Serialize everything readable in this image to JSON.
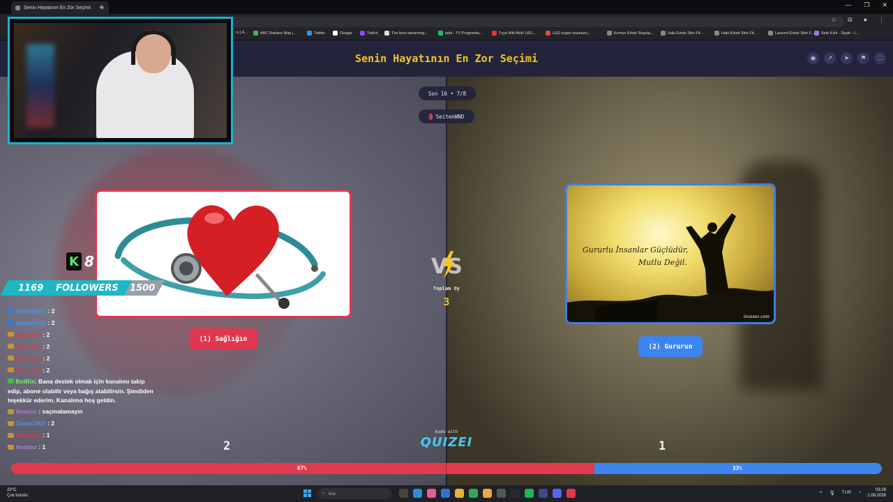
{
  "browser": {
    "tab_title": "Senin Hayatının En Zor Seçimi",
    "bookmarks": [
      "ARC Raiders Map |...",
      "Twitter",
      "Google",
      "Twitch",
      "The best streaming...",
      "tabii - TV Programla...",
      "Tuya Wifi Akıllı LED...",
      "LED ücgen kuantum...",
      "Kırmızı Erkek Regula...",
      "Haki Erkek Slim Fit...",
      "Haki Erkek Slim Fit...",
      "Lacivert Erkek Slim F...",
      "Sele Kılıfı - Siyah - L..."
    ],
    "bookmark_fragment": "rs | A..."
  },
  "quiz": {
    "title": "Senin Hayatının En Zor Seçimi",
    "round": "Son 16 • 7/8",
    "user": "SeitenWND",
    "total_label": "Toplam Oy",
    "total_votes": "3",
    "made_with": "made with",
    "brand": "QUIZEI",
    "option_a": {
      "label": "(1) Sağlığın",
      "votes": "2",
      "percent_label": "67%",
      "share": 0.67,
      "color": "#e23a4e"
    },
    "option_b": {
      "label": "(2) Gururun",
      "votes": "1",
      "percent_label": "33%",
      "share": 0.33,
      "color": "#3d85ee",
      "quote_line1": "Gururlu İnsanlar Güçlüdür,",
      "quote_line2": "Mutlu Değil.",
      "watermark": "incesoz.com"
    },
    "header_icons": [
      "eye-icon",
      "share-icon",
      "send-icon",
      "flag-icon",
      "fullscreen-icon"
    ]
  },
  "overlay": {
    "kick_letter": "K",
    "kick_count": "8",
    "followers_current": "1169",
    "followers_label": "FOLLOWERS",
    "followers_goal": "1500"
  },
  "chat": [
    {
      "user": "santafer34",
      "msg": ": 2",
      "color": "#4d8ef0"
    },
    {
      "user": "santafer34",
      "msg": ": 2",
      "color": "#4d8ef0"
    },
    {
      "user": "Maycayy",
      "msg": ": 2",
      "color": "#e0374f"
    },
    {
      "user": "Maycayy",
      "msg": ": 2",
      "color": "#e0374f"
    },
    {
      "user": "Maycayy",
      "msg": ": 2",
      "color": "#e0374f"
    },
    {
      "user": "Maycayy",
      "msg": ": 2",
      "color": "#e0374f"
    }
  ],
  "chat_bot": {
    "user": "BotRix",
    "msg": ": Bana destek olmak için kanalımı takip edip, abone olabilir veya bağış atabilirsin. Şimdiden teşekkür ederim. Kanalıma hoş geldin."
  },
  "chat_tail": [
    {
      "user": "bnazco",
      "msg": ": saçmalamayın",
      "color": "#b07fe0"
    },
    {
      "user": "Sarak1000",
      "msg": ": 2",
      "color": "#4d8ef0"
    },
    {
      "user": "Maycayy",
      "msg": ": 1",
      "color": "#e0374f"
    },
    {
      "user": "bnazco",
      "msg": ": 1",
      "color": "#b07fe0"
    }
  ],
  "taskbar": {
    "temperature": "22°C",
    "weather": "Çok bulutlu",
    "search": "Ara",
    "lang": "TUR",
    "time": "03:28",
    "date": "1.08.2026"
  }
}
